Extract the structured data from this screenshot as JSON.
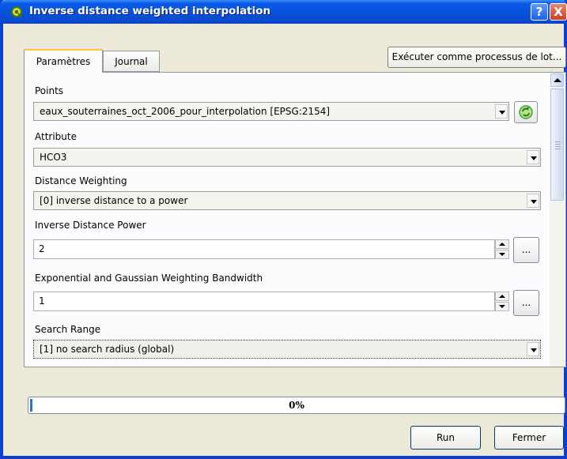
{
  "window": {
    "title": "Inverse distance weighted interpolation",
    "help_label": "?",
    "close_label": "X"
  },
  "tabs": [
    {
      "label": "Paramètres",
      "active": true
    },
    {
      "label": "Journal",
      "active": false
    }
  ],
  "batch_button": "Exécuter comme processus de lot...",
  "params": {
    "points": {
      "label": "Points",
      "value": "eaux_souterraines_oct_2006_pour_interpolation [EPSG:2154]"
    },
    "attribute": {
      "label": "Attribute",
      "value": "HCO3"
    },
    "weighting": {
      "label": "Distance Weighting",
      "value": "[0] inverse distance to a power"
    },
    "power": {
      "label": "Inverse Distance Power",
      "value": "2",
      "button": "..."
    },
    "bandwidth": {
      "label": "Exponential and Gaussian Weighting Bandwidth",
      "value": "1",
      "button": "..."
    },
    "search_range": {
      "label": "Search Range",
      "value": "[1] no search radius (global)"
    }
  },
  "progress": {
    "value": 0,
    "label": "0%"
  },
  "buttons": {
    "run": "Run",
    "close": "Fermer"
  },
  "icons": {
    "app": "qgis-icon",
    "iterate": "iterate-icon"
  },
  "colors": {
    "titlebar": "#0a50d8",
    "progress_fill": "#2b6ed8",
    "iterate_icon": "#3aa335"
  }
}
